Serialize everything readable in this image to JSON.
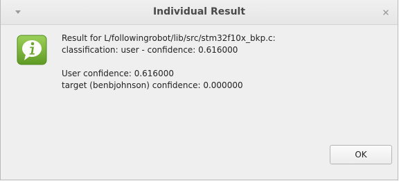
{
  "window": {
    "title": "Individual Result"
  },
  "message": {
    "line1": "Result for L/followingrobot/lib/src/stm32f10x_bkp.c:",
    "line2": "classification: user - confidence: 0.616000",
    "line3": "User confidence: 0.616000",
    "line4": "target (benbjohnson) confidence: 0.000000"
  },
  "buttons": {
    "ok_label": "OK"
  },
  "icons": {
    "info": "info-icon",
    "menu": "chevron-down-icon",
    "close": "close-icon"
  },
  "colors": {
    "info_icon_green": "#7bb43a",
    "window_bg": "#efefef"
  }
}
